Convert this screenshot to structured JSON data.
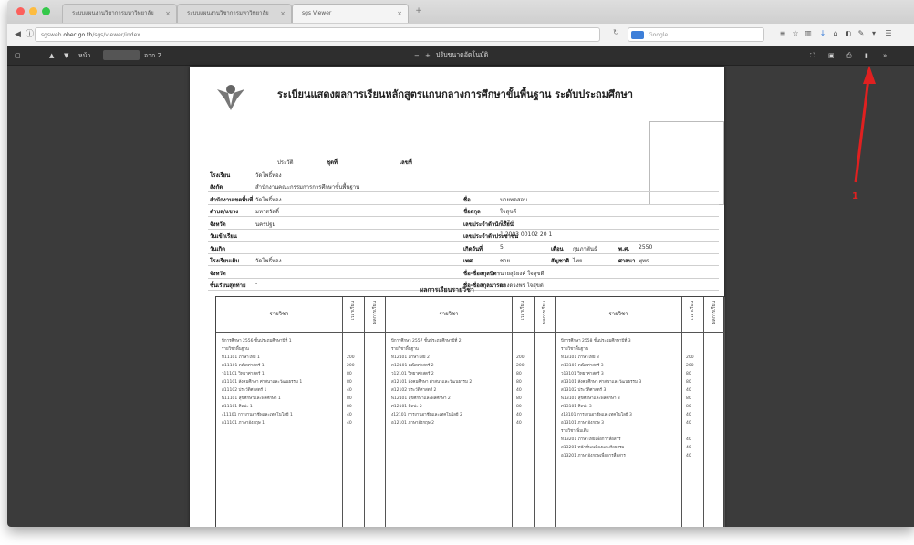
{
  "browser": {
    "tabs": [
      {
        "label": "ระบบแผนงานวิชาการมหาวิทยาลัย"
      },
      {
        "label": "ระบบแผนงานวิชาการมหาวิทยาลัย"
      },
      {
        "label": "sgs Viewer"
      }
    ],
    "url_prefix": "sgsweb",
    "url_host": ".obec.go.th",
    "url_path": "/sgs/viewer/index",
    "search_placeholder": "Google"
  },
  "pdf_toolbar": {
    "page_label": "หน้า",
    "page_total": "จาก 2",
    "zoom": "ปรับขนาดอัตโนมัติ"
  },
  "document": {
    "title": "ระเบียนแสดงผลการเรียนหลักสูตรแกนกลางการศึกษาขั้นพื้นฐาน ระดับประถมศึกษา",
    "header_fields": [
      {
        "label": "ประวัติ",
        "value": "ชุดที่",
        "extra": "เลขที่"
      },
      {
        "label": "โรงเรียน",
        "value": "วัดโพธิ์ทอง"
      },
      {
        "label": "สังกัด",
        "value": "สำนักงานคณะกรรมการการศึกษาขั้นพื้นฐาน"
      },
      {
        "label": "สำนักงานเขตพื้นที่",
        "value": "วัดโพธิ์ทอง",
        "r_label": "ชื่อ",
        "r_value": "นายทดสอบ"
      },
      {
        "label": "ตำบล/แขวง",
        "value": "มหาสวัสดิ์",
        "r_label": "ชื่อสกุล",
        "r_value": "ใจสุขดี"
      },
      {
        "label": "จังหวัด",
        "value": "นครปฐม",
        "r_label": "เลขประจำตัวนักเรียน",
        "r_value": "5074"
      },
      {
        "label": "วันเข้าเรียน",
        "value": "",
        "r_label": "เลขประจำตัวประชาชน",
        "r_value": "1 2003 00102 20 1"
      },
      {
        "label": "วันเกิด",
        "value": "",
        "r_label": "เกิดวันที่",
        "r_value": "5",
        "r2_label": "เดือน",
        "r2_value": "กุมภาพันธ์",
        "r3_label": "พ.ศ.",
        "r3_value": "2550"
      },
      {
        "label": "โรงเรียนเดิม",
        "value": "วัดโพธิ์ทอง",
        "r_label": "เพศ",
        "r_value": "ชาย",
        "r2_label": "สัญชาติ",
        "r2_value": "ไทย",
        "r3_label": "ศาสนา",
        "r3_value": "พุทธ"
      },
      {
        "label": "จังหวัด",
        "value": "-",
        "r_label": "ชื่อ-ชื่อสกุลบิดา",
        "r_value": "นายสุริยงค์ ใจสุขดี"
      },
      {
        "label": "ชั้นเรียนสุดท้าย",
        "value": "-",
        "r_label": "ชื่อ-ชื่อสกุลมารดา",
        "r_value": "นางดวงพร ใจสุขดี"
      }
    ],
    "section_title": "ผลการเรียนรายวิชา",
    "table": {
      "columns": [
        {
          "header": "รายวิชา",
          "h1": "เวลาเรียน",
          "h2": "ผลการเรียน",
          "rows": [
            {
              "name": "ปีการศึกษา 2556 ชั้นประถมศึกษาปีที่ 1",
              "hours": "",
              "grade": ""
            },
            {
              "name": "รายวิชาพื้นฐาน",
              "hours": "",
              "grade": ""
            },
            {
              "name": "ท11101 ภาษาไทย 1",
              "hours": "200",
              "grade": ""
            },
            {
              "name": "ค11101 คณิตศาสตร์ 1",
              "hours": "200",
              "grade": ""
            },
            {
              "name": "ว11101 วิทยาศาสตร์ 1",
              "hours": "80",
              "grade": ""
            },
            {
              "name": "ส11101 สังคมศึกษา ศาสนาและวัฒนธรรม 1",
              "hours": "80",
              "grade": ""
            },
            {
              "name": "ส11102 ประวัติศาสตร์ 1",
              "hours": "40",
              "grade": ""
            },
            {
              "name": "พ11101 สุขศึกษาและพลศึกษา 1",
              "hours": "80",
              "grade": ""
            },
            {
              "name": "ศ11101 ศิลปะ 1",
              "hours": "80",
              "grade": ""
            },
            {
              "name": "ง11101 การงานอาชีพและเทคโนโลยี 1",
              "hours": "40",
              "grade": ""
            },
            {
              "name": "อ11101 ภาษาอังกฤษ 1",
              "hours": "40",
              "grade": ""
            }
          ]
        },
        {
          "header": "รายวิชา",
          "h1": "เวลาเรียน",
          "h2": "ผลการเรียน",
          "rows": [
            {
              "name": "ปีการศึกษา 2557 ชั้นประถมศึกษาปีที่ 2",
              "hours": "",
              "grade": ""
            },
            {
              "name": "รายวิชาพื้นฐาน",
              "hours": "",
              "grade": ""
            },
            {
              "name": "ท12101 ภาษาไทย 2",
              "hours": "200",
              "grade": ""
            },
            {
              "name": "ค12101 คณิตศาสตร์ 2",
              "hours": "200",
              "grade": ""
            },
            {
              "name": "ว12101 วิทยาศาสตร์ 2",
              "hours": "80",
              "grade": ""
            },
            {
              "name": "ส12101 สังคมศึกษา ศาสนาและวัฒนธรรม 2",
              "hours": "80",
              "grade": ""
            },
            {
              "name": "ส12102 ประวัติศาสตร์ 2",
              "hours": "40",
              "grade": ""
            },
            {
              "name": "พ12101 สุขศึกษาและพลศึกษา 2",
              "hours": "80",
              "grade": ""
            },
            {
              "name": "ศ12101 ศิลปะ 2",
              "hours": "80",
              "grade": ""
            },
            {
              "name": "ง12101 การงานอาชีพและเทคโนโลยี 2",
              "hours": "40",
              "grade": ""
            },
            {
              "name": "อ12101 ภาษาอังกฤษ 2",
              "hours": "40",
              "grade": ""
            }
          ]
        },
        {
          "header": "รายวิชา",
          "h1": "เวลาเรียน",
          "h2": "ผลการเรียน",
          "rows": [
            {
              "name": "ปีการศึกษา 2558 ชั้นประถมศึกษาปีที่ 3",
              "hours": "",
              "grade": ""
            },
            {
              "name": "รายวิชาพื้นฐาน",
              "hours": "",
              "grade": ""
            },
            {
              "name": "ท13101 ภาษาไทย 3",
              "hours": "200",
              "grade": ""
            },
            {
              "name": "ค13101 คณิตศาสตร์ 3",
              "hours": "200",
              "grade": ""
            },
            {
              "name": "ว13101 วิทยาศาสตร์ 3",
              "hours": "80",
              "grade": ""
            },
            {
              "name": "ส13101 สังคมศึกษา ศาสนาและวัฒนธรรม 3",
              "hours": "80",
              "grade": ""
            },
            {
              "name": "ส13102 ประวัติศาสตร์ 3",
              "hours": "40",
              "grade": ""
            },
            {
              "name": "พ13101 สุขศึกษาและพลศึกษา 3",
              "hours": "80",
              "grade": ""
            },
            {
              "name": "ศ13101 ศิลปะ 3",
              "hours": "80",
              "grade": ""
            },
            {
              "name": "ง13101 การงานอาชีพและเทคโนโลยี 3",
              "hours": "40",
              "grade": ""
            },
            {
              "name": "อ13101 ภาษาอังกฤษ 3",
              "hours": "40",
              "grade": ""
            },
            {
              "name": "รายวิชาเพิ่มเติม",
              "hours": "",
              "grade": ""
            },
            {
              "name": "ท13201 ภาษาไทยเพื่อการสื่อสาร",
              "hours": "40",
              "grade": ""
            },
            {
              "name": "ส13201 หน้าที่พลเมืองและศีลธรรม",
              "hours": "40",
              "grade": ""
            },
            {
              "name": "อ13201 ภาษาอังกฤษเพื่อการสื่อสาร",
              "hours": "40",
              "grade": ""
            }
          ]
        }
      ]
    }
  },
  "annotation": {
    "label": "1",
    "color": "#e02020"
  }
}
